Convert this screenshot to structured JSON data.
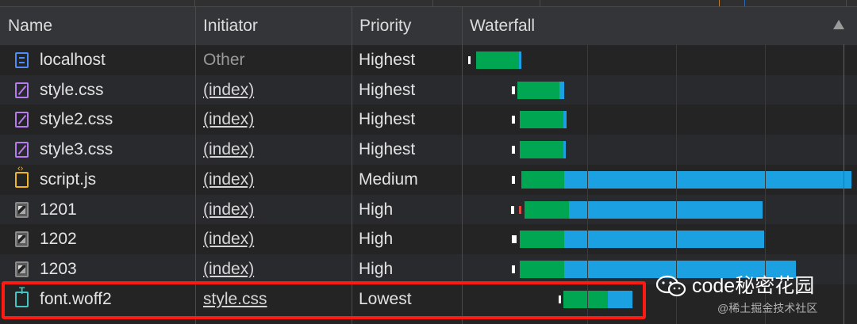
{
  "columns": {
    "name": "Name",
    "initiator": "Initiator",
    "priority": "Priority",
    "waterfall": "Waterfall"
  },
  "rows": [
    {
      "name": "localhost",
      "initiator": "Other",
      "priority": "Highest",
      "icon": "document-icon"
    },
    {
      "name": "style.css",
      "initiator": "(index)",
      "priority": "Highest",
      "icon": "stylesheet-icon"
    },
    {
      "name": "style2.css",
      "initiator": "(index)",
      "priority": "Highest",
      "icon": "stylesheet-icon"
    },
    {
      "name": "style3.css",
      "initiator": "(index)",
      "priority": "Highest",
      "icon": "stylesheet-icon"
    },
    {
      "name": "script.js",
      "initiator": "(index)",
      "priority": "Medium",
      "icon": "script-icon"
    },
    {
      "name": "1201",
      "initiator": "(index)",
      "priority": "High",
      "icon": "image-icon"
    },
    {
      "name": "1202",
      "initiator": "(index)",
      "priority": "High",
      "icon": "image-icon"
    },
    {
      "name": "1203",
      "initiator": "(index)",
      "priority": "High",
      "icon": "image-icon"
    },
    {
      "name": "font.woff2",
      "initiator": "style.css",
      "priority": "Lowest",
      "icon": "font-icon"
    }
  ],
  "colors": {
    "waiting": "#00a651",
    "download": "#1ba1e2",
    "highlight": "#ff1a12"
  },
  "watermark": {
    "title": "code秘密花园",
    "subtitle": "@稀土掘金技术社区"
  }
}
